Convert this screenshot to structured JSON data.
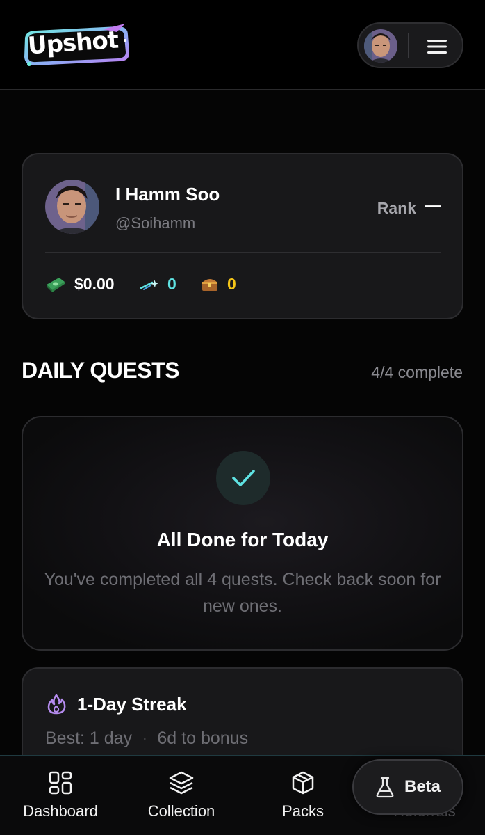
{
  "header": {
    "logo_text": "Upshot",
    "menu_icon": "hamburger-icon"
  },
  "profile": {
    "name": "I Hamm Soo",
    "handle": "@Soihamm",
    "rank_label": "Rank",
    "rank_value": "—",
    "stats": [
      {
        "icon": "cash-icon",
        "value": "$0.00",
        "color": "#ffffff"
      },
      {
        "icon": "shooting-star-icon",
        "value": "0",
        "color": "#5fe3e3"
      },
      {
        "icon": "treasure-chest-icon",
        "value": "0",
        "color": "#f5c518"
      }
    ]
  },
  "daily_quests": {
    "title": "DAILY QUESTS",
    "progress": "4/4 complete",
    "done_title": "All Done for Today",
    "done_text": "You've completed all 4 quests. Check back soon for new ones."
  },
  "streak": {
    "title": "1-Day Streak",
    "best": "Best: 1 day",
    "separator": "·",
    "bonus": "6d to bonus"
  },
  "nav": {
    "items": [
      {
        "label": "Dashboard",
        "icon": "grid-icon"
      },
      {
        "label": "Collection",
        "icon": "layers-icon"
      },
      {
        "label": "Packs",
        "icon": "box-icon"
      },
      {
        "label": "Referrals",
        "icon": "referrals-icon"
      }
    ],
    "beta_label": "Beta",
    "beta_icon": "flask-icon"
  },
  "colors": {
    "accent_teal": "#5fe3e3",
    "accent_gold": "#f5c518",
    "streak_purple": "#b68cf0",
    "background": "#050505",
    "card": "#18181a"
  }
}
